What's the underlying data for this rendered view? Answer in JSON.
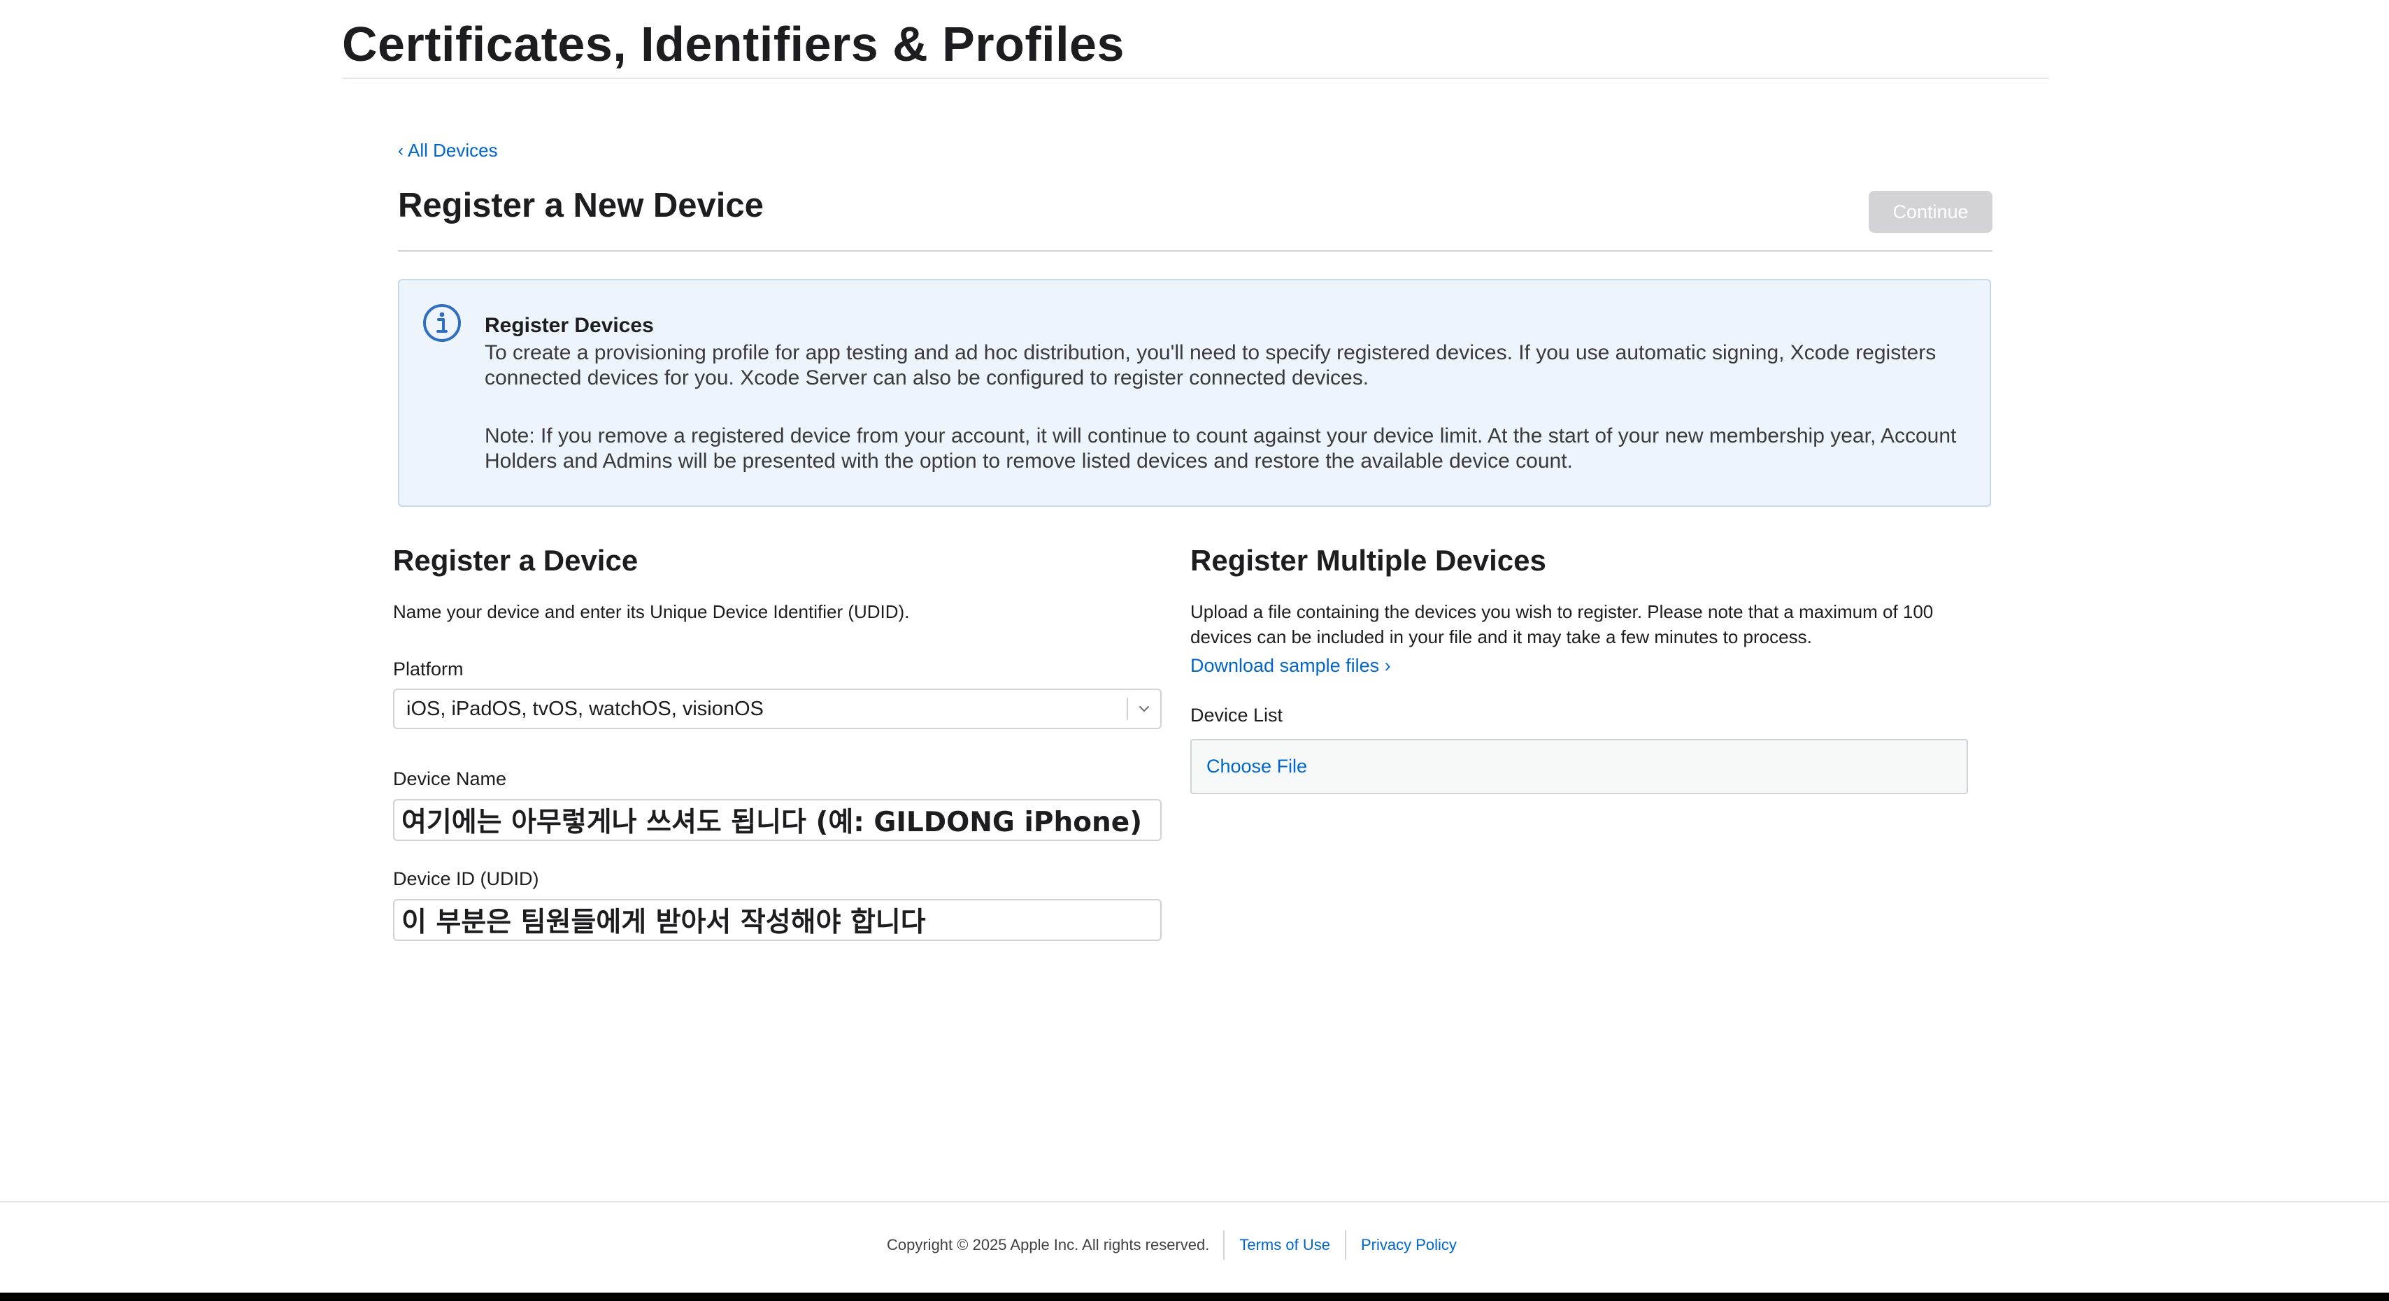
{
  "header": {
    "title": "Certificates, Identifiers & Profiles"
  },
  "nav": {
    "back_label": "All Devices",
    "back_icon": "chevron-left-icon"
  },
  "page": {
    "title": "Register a New Device",
    "continue_label": "Continue"
  },
  "info": {
    "icon": "info-circle-icon",
    "title": "Register Devices",
    "paragraph1": "To create a provisioning profile for app testing and ad hoc distribution, you'll need to specify registered devices. If you use automatic signing, Xcode registers connected devices for you. Xcode Server can also be configured to register connected devices.",
    "paragraph2": "Note: If you remove a registered device from your account, it will continue to count against your device limit. At the start of your new membership year, Account Holders and Admins will be presented with the option to remove listed devices and restore the available device count."
  },
  "single": {
    "heading": "Register a Device",
    "description": "Name your device and enter its Unique Device Identifier (UDID).",
    "platform_label": "Platform",
    "platform_value": "iOS, iPadOS, tvOS, watchOS, visionOS",
    "device_name_label": "Device Name",
    "device_name_value": "여기에는 아무렇게나 쓰셔도 됩니다 (예: GILDONG iPhone)",
    "device_id_label": "Device ID (UDID)",
    "device_id_value": "이 부분은 팀원들에게 받아서 작성해야 합니다"
  },
  "multiple": {
    "heading": "Register Multiple Devices",
    "description": "Upload a file containing the devices you wish to register. Please note that a maximum of 100 devices can be included in your file and it may take a few minutes to process.",
    "download_label": "Download sample files",
    "device_list_label": "Device List",
    "choose_file_label": "Choose File"
  },
  "footer": {
    "copyright": "Copyright © 2025 Apple Inc. All rights reserved.",
    "terms_label": "Terms of Use",
    "privacy_label": "Privacy Policy"
  },
  "colors": {
    "link": "#0066cc",
    "disabled_button": "#d2d2d7",
    "info_background": "#eef4fb",
    "info_icon": "#2f6fc1"
  }
}
